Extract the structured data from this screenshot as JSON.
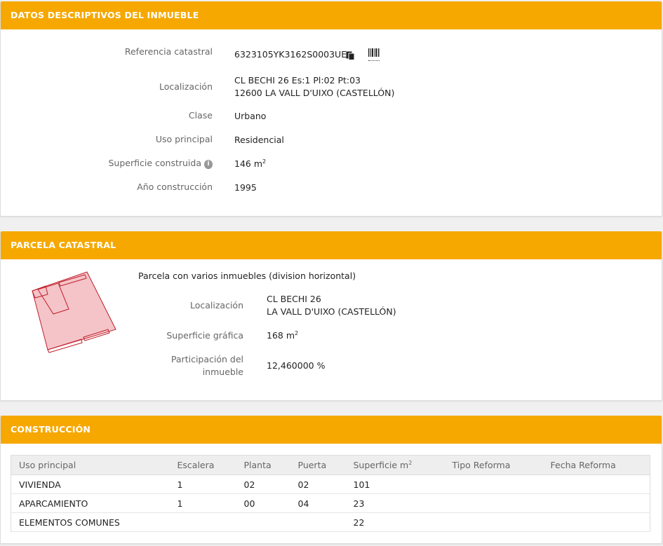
{
  "datos": {
    "header": "DATOS DESCRIPTIVOS DEL INMUEBLE",
    "referencia_label": "Referencia catastral",
    "referencia_value": "6323105YK3162S0003UE",
    "localizacion_label": "Localización",
    "localizacion_line1": "CL BECHI 26 Es:1 Pl:02 Pt:03",
    "localizacion_line2": "12600 LA VALL D'UIXO (CASTELLÓN)",
    "clase_label": "Clase",
    "clase_value": "Urbano",
    "uso_label": "Uso principal",
    "uso_value": "Residencial",
    "superficie_label": "Superficie construida",
    "superficie_value": "146 m",
    "superficie_unit_exp": "2",
    "anio_label": "Año construcción",
    "anio_value": "1995"
  },
  "parcela": {
    "header": "PARCELA CATASTRAL",
    "descripcion": "Parcela con varios inmuebles (division horizontal)",
    "localizacion_label": "Localización",
    "localizacion_line1": "CL BECHI 26",
    "localizacion_line2": "LA VALL D'UIXO (CASTELLÓN)",
    "superficie_label": "Superficie gráfica",
    "superficie_value": "168 m",
    "superficie_unit_exp": "2",
    "participacion_label_line1": "Participación del",
    "participacion_label_line2": "inmueble",
    "participacion_value": "12,460000 %"
  },
  "construccion": {
    "header": "CONSTRUCCIÓN",
    "columns": [
      "Uso principal",
      "Escalera",
      "Planta",
      "Puerta",
      "Superficie m",
      "Tipo Reforma",
      "Fecha Reforma"
    ],
    "superficie_col_exp": "2",
    "rows": [
      [
        "VIVIENDA",
        "1",
        "02",
        "02",
        "101",
        "",
        ""
      ],
      [
        "APARCAMIENTO",
        "1",
        "00",
        "04",
        "23",
        "",
        ""
      ],
      [
        "ELEMENTOS COMUNES",
        "",
        "",
        "",
        "22",
        "",
        ""
      ]
    ]
  },
  "icons": {
    "copy": "copy-icon",
    "barcode": "barcode-icon",
    "info": "info-icon"
  },
  "colors": {
    "header_bg": "#f6a800",
    "parcel_fill": "#f4c4c8",
    "parcel_stroke": "#c0202c"
  }
}
